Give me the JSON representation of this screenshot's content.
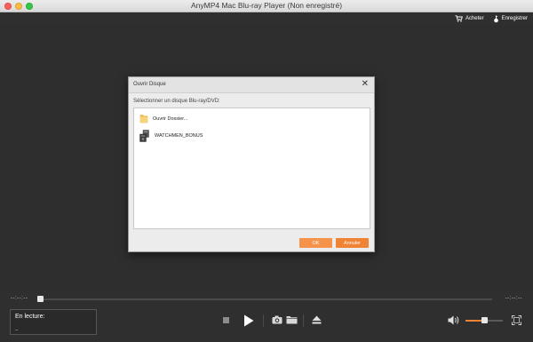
{
  "app": {
    "title": "AnyMP4 Mac Blu-ray Player (Non enregistré)"
  },
  "topbar": {
    "buy_label": "Acheter",
    "register_label": "Enregistrer"
  },
  "dialog": {
    "title": "Ouvrir Disque",
    "close_glyph": "✕",
    "subtitle": "Sélectionner un disque Blu-ray/DVD:",
    "items": [
      {
        "label": "Ouvrir Dossier...",
        "icon": "folder-icon"
      },
      {
        "label": "WATCHMEN_BONUS",
        "icon": "disc-drive-icon"
      }
    ],
    "ok_label": "OK",
    "cancel_label": "Annuler"
  },
  "player": {
    "time_elapsed": "--:--:--",
    "time_total": "--:--:--",
    "progress": 0,
    "status_label": "En lecture:",
    "status_value": "_",
    "volume": 0.5
  },
  "colors": {
    "accent": "#f18335",
    "background": "#2f2f2f"
  }
}
